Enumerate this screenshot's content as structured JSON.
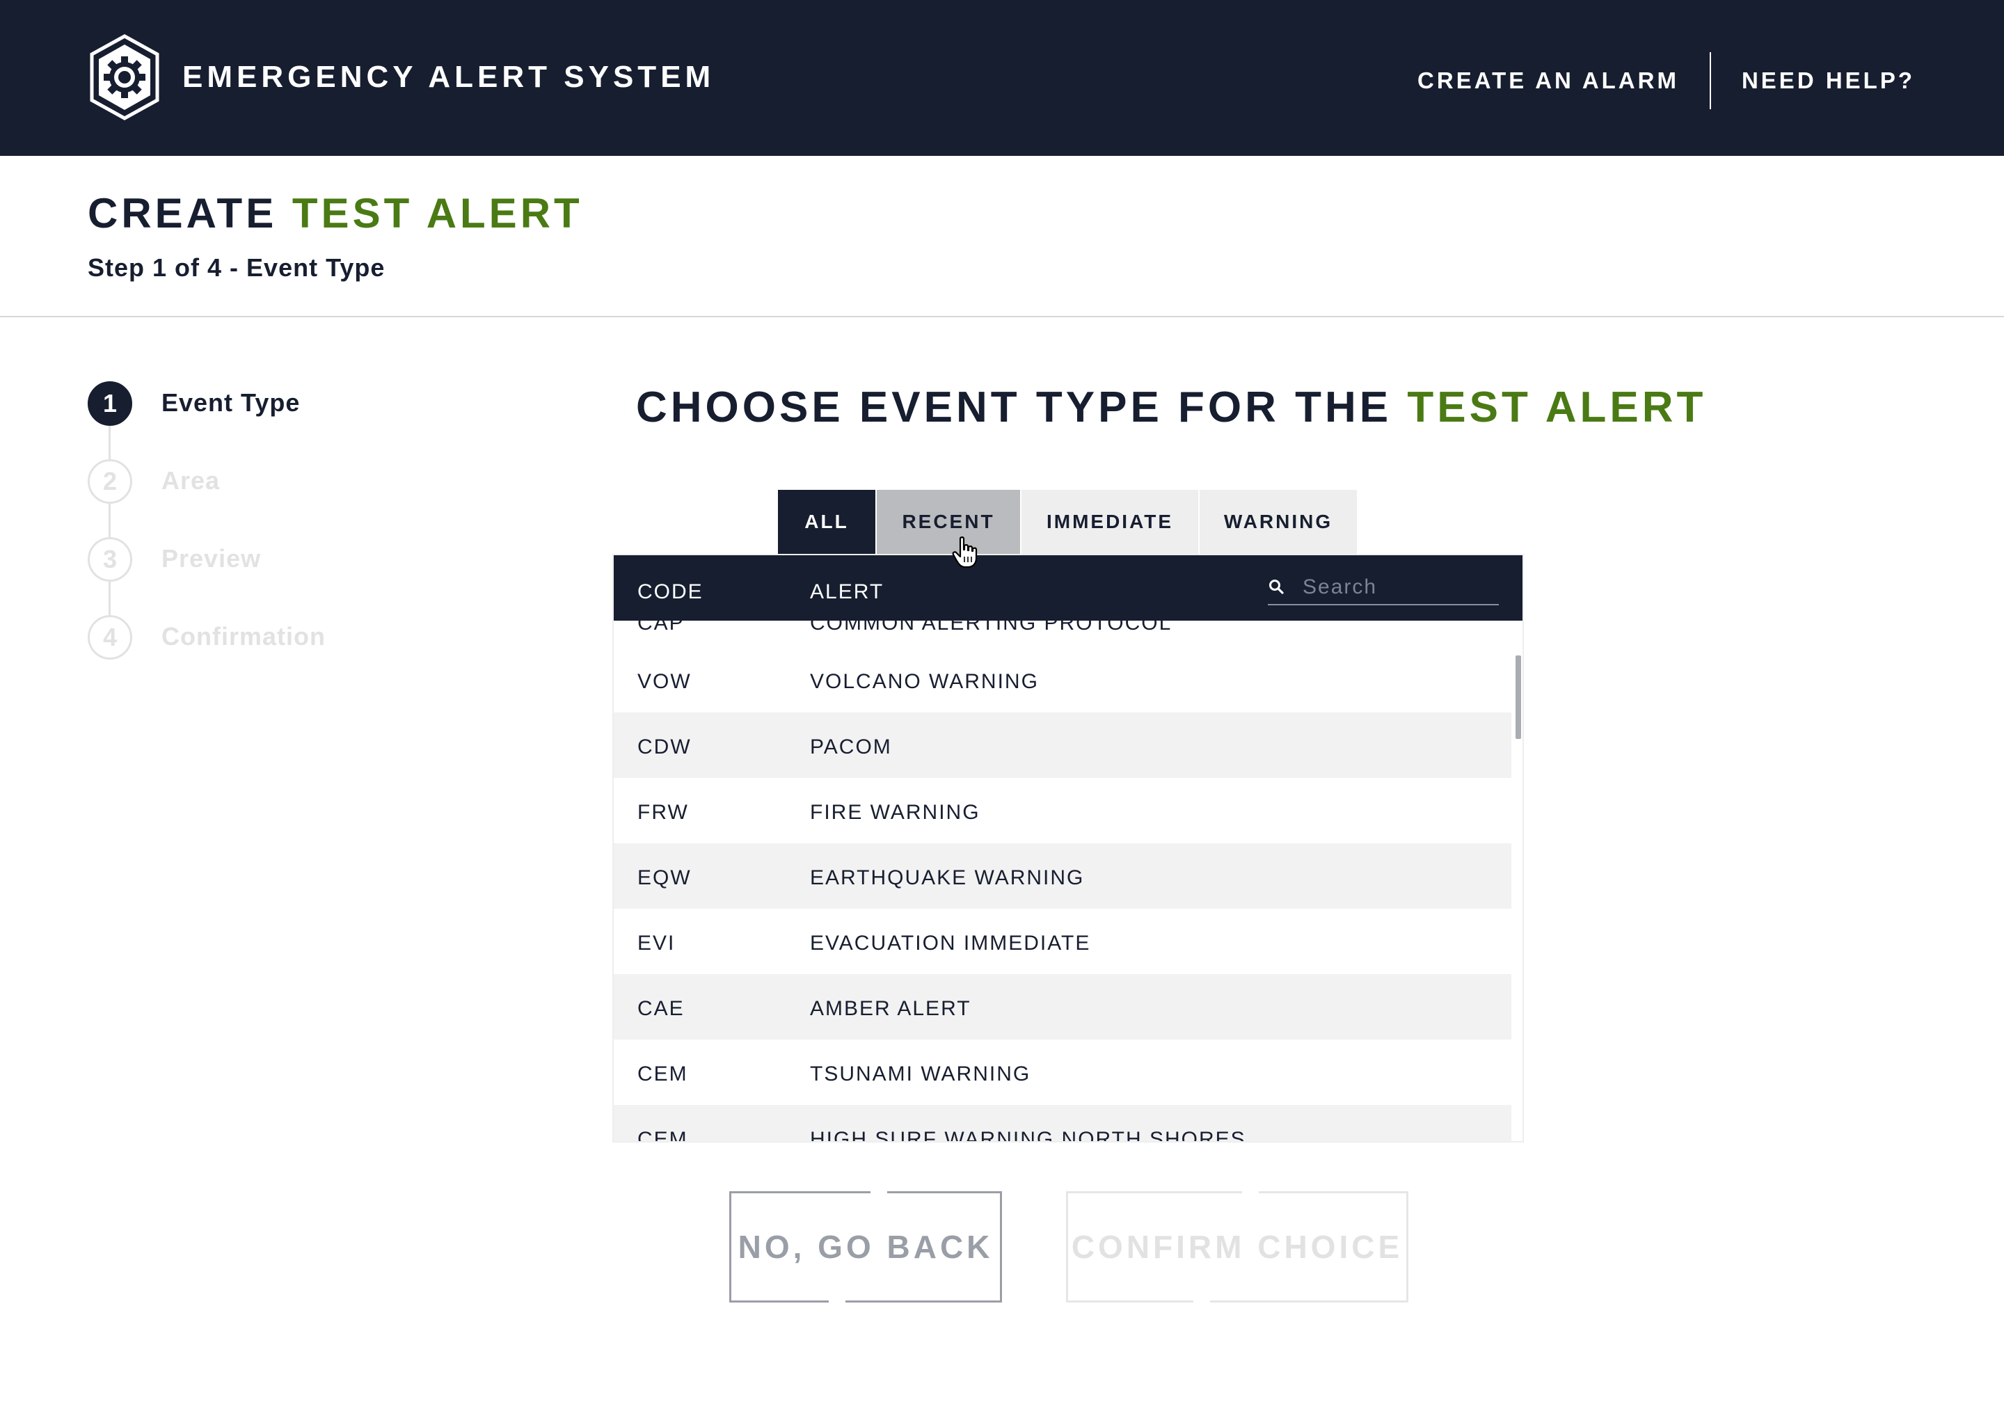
{
  "header": {
    "title": "EMERGENCY ALERT SYSTEM",
    "logo_icon": "gear-shield-icon",
    "links": {
      "create_alarm": "CREATE AN ALARM",
      "need_help": "NEED HELP?"
    }
  },
  "page": {
    "title_prefix": "CREATE ",
    "title_accent": "TEST ALERT",
    "step_text": "Step 1 of 4 - Event Type"
  },
  "stepper": {
    "steps": [
      {
        "number": "1",
        "label": "Event Type",
        "active": true
      },
      {
        "number": "2",
        "label": "Area",
        "active": false
      },
      {
        "number": "3",
        "label": "Preview",
        "active": false
      },
      {
        "number": "4",
        "label": "Confirmation",
        "active": false
      }
    ]
  },
  "main": {
    "heading_prefix": "CHOOSE EVENT TYPE FOR THE ",
    "heading_accent": "TEST ALERT"
  },
  "tabs": {
    "items": [
      {
        "label": "ALL",
        "state": "selected"
      },
      {
        "label": "RECENT",
        "state": "hover"
      },
      {
        "label": "IMMEDIATE",
        "state": "default"
      },
      {
        "label": "WARNING",
        "state": "default"
      }
    ]
  },
  "table": {
    "columns": {
      "code": "CODE",
      "alert": "ALERT"
    },
    "search": {
      "placeholder": "Search",
      "value": ""
    },
    "rows": [
      {
        "code": "CAP",
        "alert": "COMMON ALERTING PROTOCOL"
      },
      {
        "code": "VOW",
        "alert": "VOLCANO WARNING"
      },
      {
        "code": "CDW",
        "alert": "PACOM"
      },
      {
        "code": "FRW",
        "alert": "FIRE WARNING"
      },
      {
        "code": "EQW",
        "alert": "EARTHQUAKE WARNING"
      },
      {
        "code": "EVI",
        "alert": "EVACUATION IMMEDIATE"
      },
      {
        "code": "CAE",
        "alert": "AMBER ALERT"
      },
      {
        "code": "CEM",
        "alert": "TSUNAMI WARNING"
      },
      {
        "code": "CEM",
        "alert": "HIGH SURF WARNING NORTH SHORES"
      }
    ]
  },
  "buttons": {
    "back": "NO, GO BACK",
    "confirm": "CONFIRM CHOICE"
  },
  "colors": {
    "navy": "#171e30",
    "accent_green": "#4a7a14",
    "row_stripe": "#f2f2f2",
    "disabled": "#e2e2e2"
  }
}
